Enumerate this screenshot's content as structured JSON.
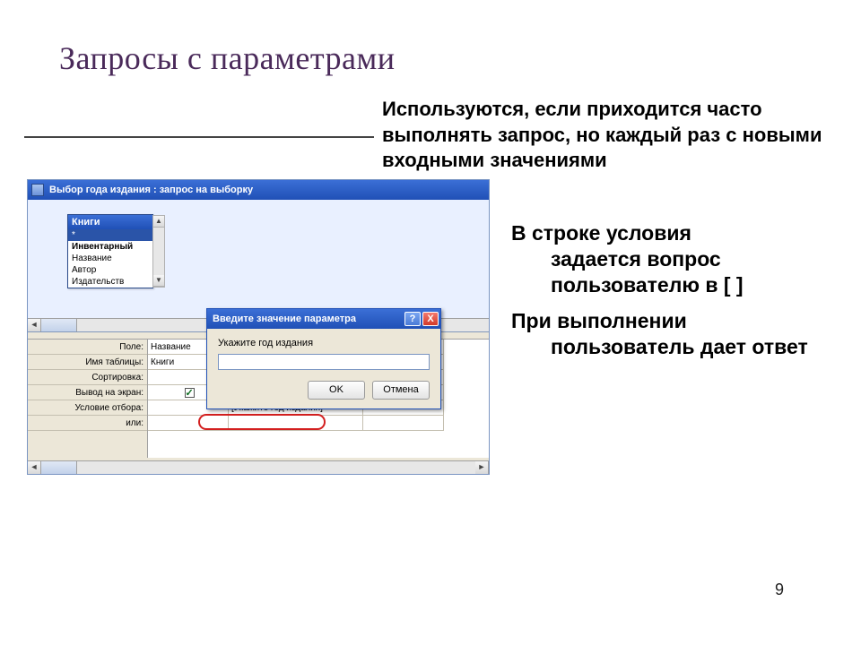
{
  "title": "Запросы с параметрами",
  "intro": "Используются, если приходится часто выполнять запрос, но каждый раз с новыми входными значениями",
  "body": {
    "p1_line1": "В строке условия",
    "p1_rest": "задается вопрос пользователю в [ ]",
    "p2_line1": "При выполнении",
    "p2_rest": "пользователь дает ответ"
  },
  "page_number": "9",
  "access_window": {
    "title": "Выбор года издания : запрос на выборку",
    "table_name": "Книги",
    "fields": [
      "*",
      "Инвентарный",
      "Название",
      "Автор",
      "Издательств"
    ],
    "grid_labels": [
      "Поле:",
      "Имя таблицы:",
      "Сортировка:",
      "Вывод на экран:",
      "Условие отбора:",
      "или:"
    ],
    "col1": {
      "field": "Название",
      "table": "Книги"
    },
    "col2": {
      "criteria": "[Укажите год издания]"
    }
  },
  "dialog": {
    "title": "Введите значение параметра",
    "label": "Укажите год издания",
    "input_value": "",
    "ok": "OK",
    "cancel": "Отмена",
    "help_glyph": "?",
    "close_glyph": "X"
  }
}
